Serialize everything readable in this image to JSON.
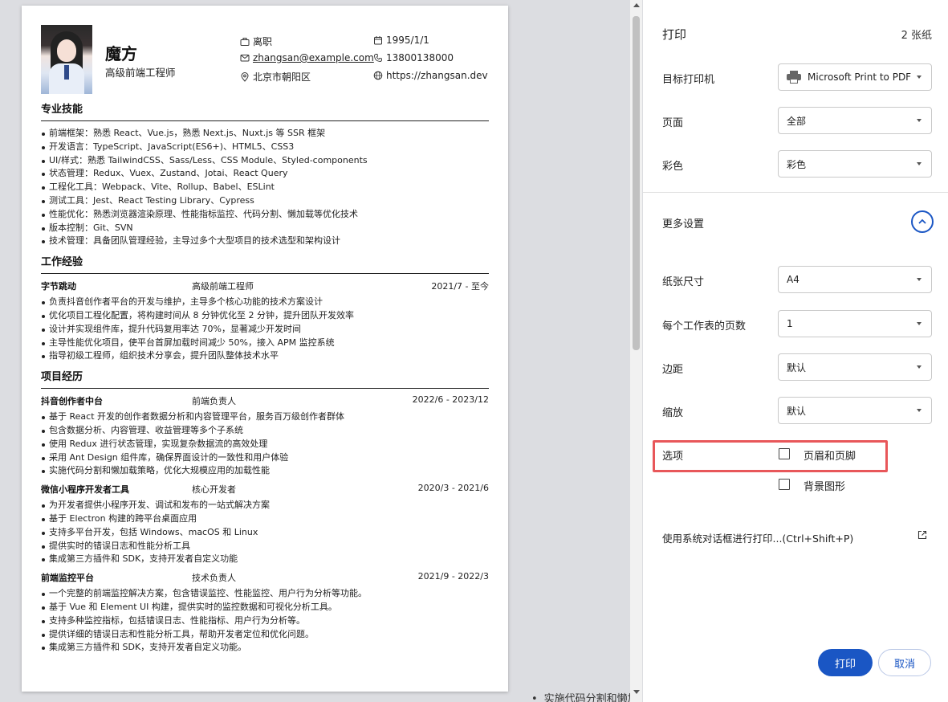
{
  "resume": {
    "name": "魔方",
    "title": "高级前端工程师",
    "info": {
      "status": "离职",
      "birthday": "1995/1/1",
      "email": "zhangsan@example.com",
      "phone": "13800138000",
      "location": "北京市朝阳区",
      "website": "https://zhangsan.dev"
    },
    "skills": {
      "heading": "专业技能",
      "items": [
        "前端框架：熟悉 React、Vue.js，熟悉 Next.js、Nuxt.js 等 SSR 框架",
        "开发语言：TypeScript、JavaScript(ES6+)、HTML5、CSS3",
        "UI/样式：熟悉 TailwindCSS、Sass/Less、CSS Module、Styled-components",
        "状态管理：Redux、Vuex、Zustand、Jotai、React Query",
        "工程化工具：Webpack、Vite、Rollup、Babel、ESLint",
        "测试工具：Jest、React Testing Library、Cypress",
        "性能优化：熟悉浏览器渲染原理、性能指标监控、代码分割、懒加载等优化技术",
        "版本控制：Git、SVN",
        "技术管理：具备团队管理经验，主导过多个大型项目的技术选型和架构设计"
      ]
    },
    "experience": {
      "heading": "工作经验",
      "entries": [
        {
          "org": "字节跳动",
          "role": "高级前端工程师",
          "date": "2021/7 - 至今",
          "items": [
            "负责抖音创作者平台的开发与维护，主导多个核心功能的技术方案设计",
            "优化项目工程化配置，将构建时间从 8 分钟优化至 2 分钟，提升团队开发效率",
            "设计并实现组件库，提升代码复用率达 70%，显著减少开发时间",
            "主导性能优化项目，使平台首屏加载时间减少 50%，接入 APM 监控系统",
            "指导初级工程师，组织技术分享会，提升团队整体技术水平"
          ]
        }
      ]
    },
    "projects": {
      "heading": "项目经历",
      "entries": [
        {
          "org": "抖音创作者中台",
          "role": "前端负责人",
          "date": "2022/6 - 2023/12",
          "items": [
            "基于 React 开发的创作者数据分析和内容管理平台，服务百万级创作者群体",
            "包含数据分析、内容管理、收益管理等多个子系统",
            "使用 Redux 进行状态管理，实现复杂数据流的高效处理",
            "采用 Ant Design 组件库，确保界面设计的一致性和用户体验",
            "实施代码分割和懒加载策略，优化大规模应用的加载性能"
          ]
        },
        {
          "org": "微信小程序开发者工具",
          "role": "核心开发者",
          "date": "2020/3 - 2021/6",
          "items": [
            "为开发者提供小程序开发、调试和发布的一站式解决方案",
            "基于 Electron 构建的跨平台桌面应用",
            "支持多平台开发，包括 Windows、macOS 和 Linux",
            "提供实时的错误日志和性能分析工具",
            "集成第三方插件和 SDK，支持开发者自定义功能"
          ]
        },
        {
          "org": "前端监控平台",
          "role": "技术负责人",
          "date": "2021/9 - 2022/3",
          "items": [
            "一个完整的前端监控解决方案，包含错误监控、性能监控、用户行为分析等功能。",
            "基于 Vue 和 Element UI 构建，提供实时的监控数据和可视化分析工具。",
            "支持多种监控指标，包括错误日志、性能指标、用户行为分析等。",
            "提供详细的错误日志和性能分析工具，帮助开发者定位和优化问题。",
            "集成第三方插件和 SDK，支持开发者自定义功能。"
          ]
        }
      ]
    },
    "bleed_line": "实施代码分割和懒加载策略，优化大规模应用的加载性能"
  },
  "print": {
    "title": "打印",
    "sheets": "2 张纸",
    "destination": {
      "label": "目标打印机",
      "value": "Microsoft Print to PDF"
    },
    "pages": {
      "label": "页面",
      "value": "全部"
    },
    "color": {
      "label": "彩色",
      "value": "彩色"
    },
    "more_settings": "更多设置",
    "paper_size": {
      "label": "纸张尺寸",
      "value": "A4"
    },
    "pages_per_sheet": {
      "label": "每个工作表的页数",
      "value": "1"
    },
    "margins": {
      "label": "边距",
      "value": "默认"
    },
    "scale": {
      "label": "缩放",
      "value": "默认"
    },
    "options": {
      "label": "选项",
      "headers_footers": "页眉和页脚",
      "background_graphics": "背景图形"
    },
    "system_dialog": "使用系统对话框进行打印...(Ctrl+Shift+P)",
    "print_button": "打印",
    "cancel_button": "取消"
  },
  "colors": {
    "accent": "#1a56c4",
    "highlight": "#e8575a"
  }
}
